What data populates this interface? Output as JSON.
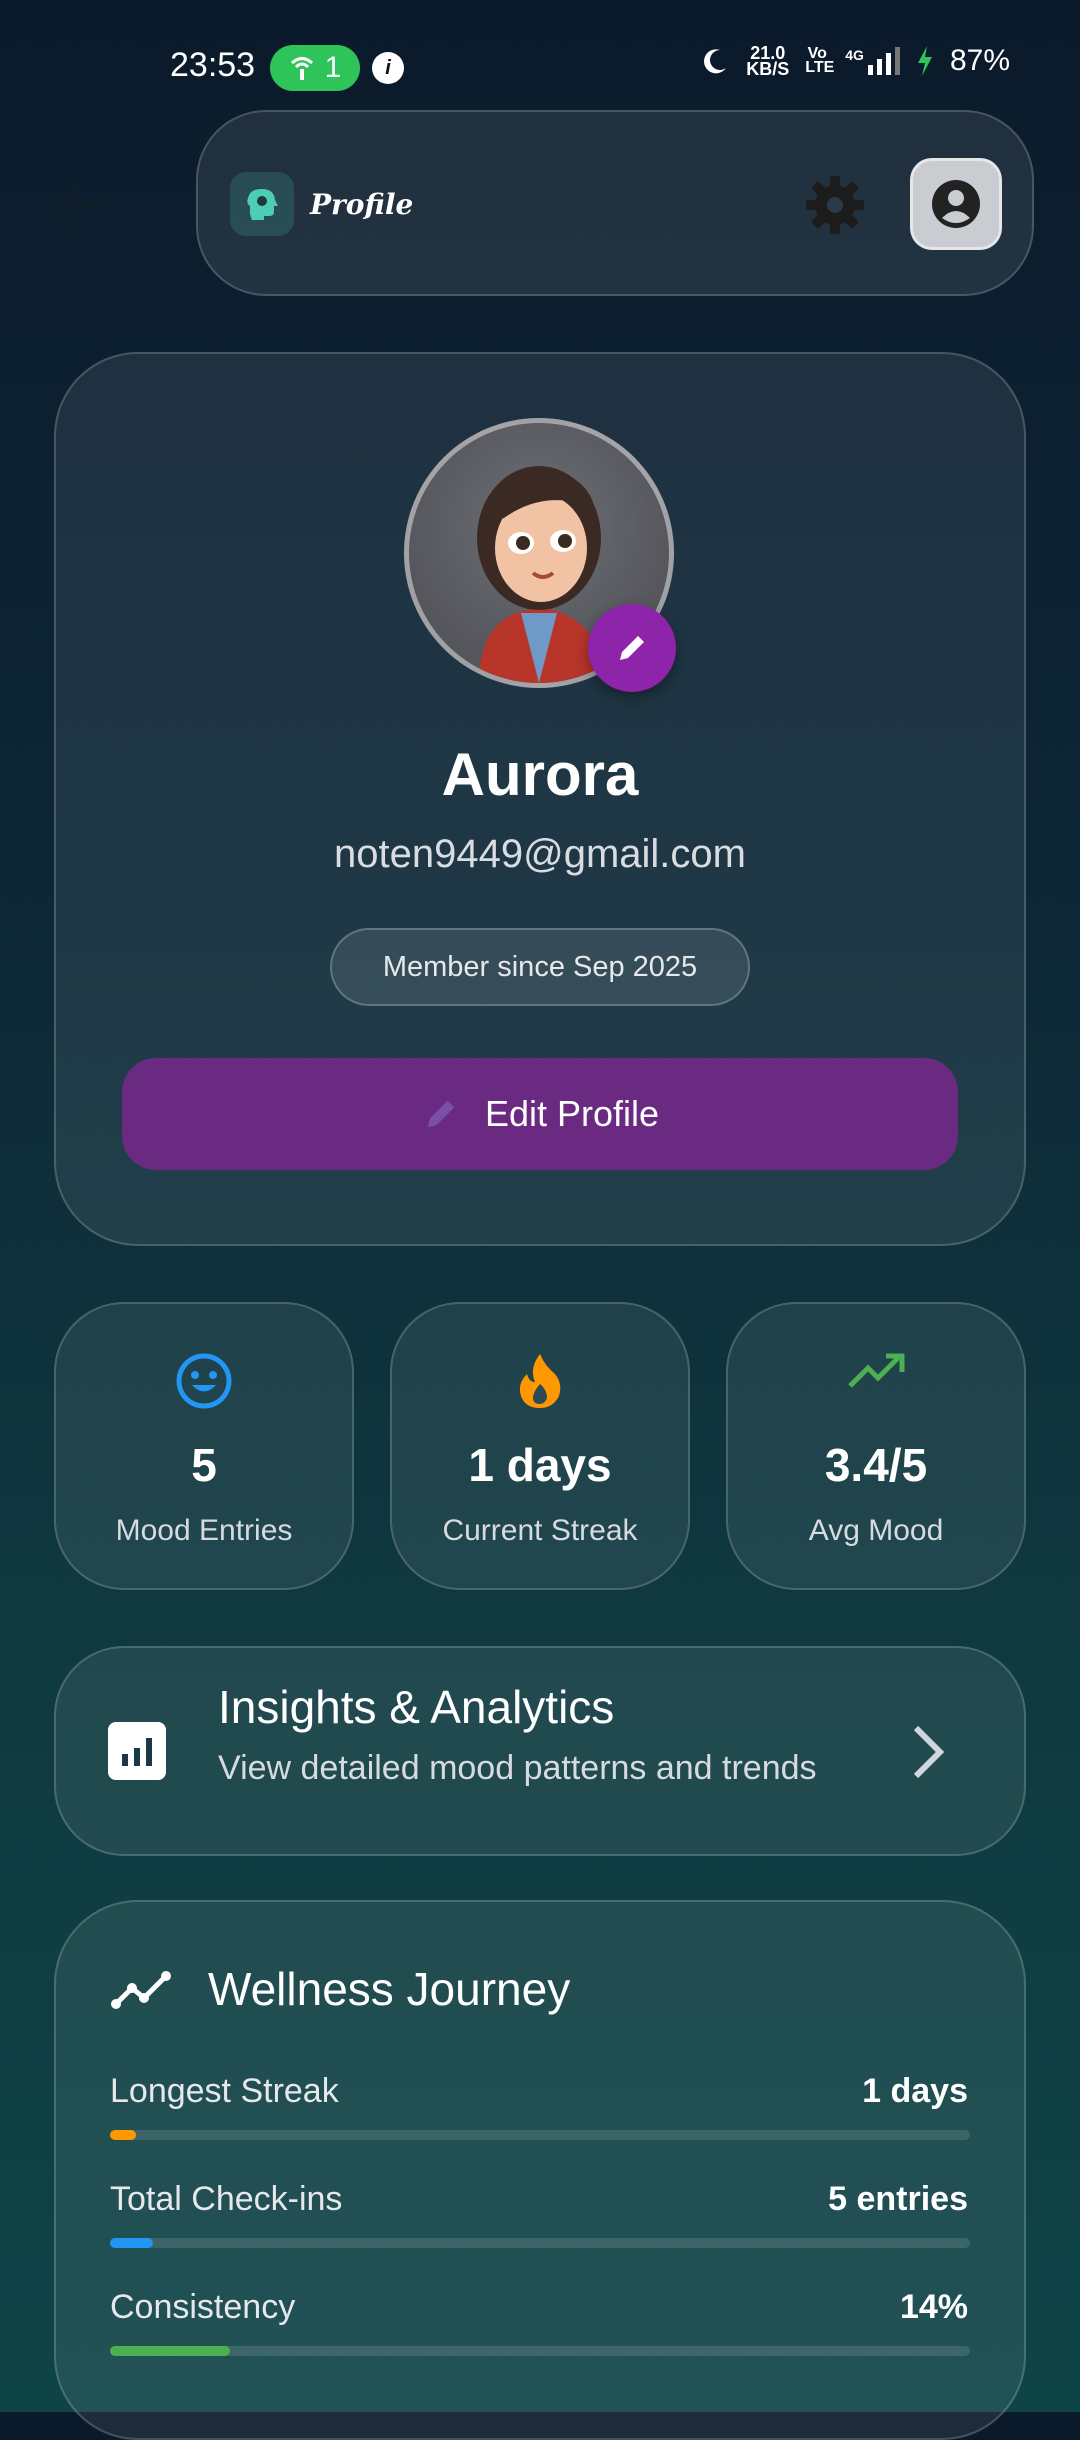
{
  "status_bar": {
    "time": "23:53",
    "hotspot_count": "1",
    "data_speed_value": "21.0",
    "data_speed_unit": "KB/S",
    "network_label": "4G",
    "volte_label": "Vo LTE",
    "battery": "87%"
  },
  "app_bar": {
    "title": "Profile",
    "icons": [
      "back-arrow-icon",
      "brain-logo-icon",
      "gear-icon",
      "account-circle-icon"
    ]
  },
  "profile": {
    "name": "Aurora",
    "email": "noten9449@gmail.com",
    "member_since": "Member since Sep 2025",
    "edit_button": "Edit Profile"
  },
  "stats": [
    {
      "value": "5",
      "label": "Mood Entries",
      "icon": "smiley-icon",
      "color": "#2196f3"
    },
    {
      "value": "1 days",
      "label": "Current Streak",
      "icon": "fire-icon",
      "color": "#ff9800"
    },
    {
      "value": "3.4/5",
      "label": "Avg Mood",
      "icon": "trending-up-icon",
      "color": "#4caf50"
    }
  ],
  "insights": {
    "title": "Insights & Analytics",
    "subtitle": "View detailed mood patterns and trends"
  },
  "wellness": {
    "title": "Wellness Journey",
    "rows": [
      {
        "label": "Longest Streak",
        "value": "1 days",
        "progress": 0.03,
        "color": "#ff9800"
      },
      {
        "label": "Total Check-ins",
        "value": "5 entries",
        "progress": 0.05,
        "color": "#2196f3"
      },
      {
        "label": "Consistency",
        "value": "14%",
        "progress": 0.14,
        "color": "#4caf50"
      }
    ]
  },
  "colors": {
    "accent_purple": "#8e24aa",
    "button_purple": "#6a2a82",
    "hotspot_green": "#2ec45a"
  }
}
